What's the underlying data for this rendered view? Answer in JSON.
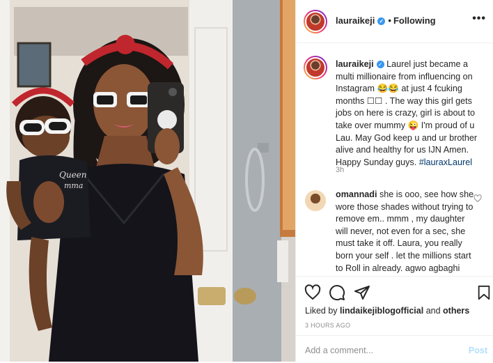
{
  "header": {
    "username": "lauraikeji",
    "separator": "•",
    "follow_status": "Following",
    "more_label": "•••"
  },
  "caption": {
    "username": "lauraikeji",
    "text": "Laurel just became a multi millionaire from influencing on Instagram 😂😂 at just 4 fcuking months ☐☐ . The way this girl gets jobs on here is crazy, girl is about to take over mummy 😜 I'm proud of u Lau. May God keep u and ur brother alive and healthy for us IJN Amen. Happy Sunday guys. ",
    "hashtag": "#lauraxLaurel",
    "time": "3h"
  },
  "comment": {
    "username": "omannadi",
    "text": "she is ooo, see how she wore those shades without trying to remove em.. mmm , my daughter will never, not even for a sec, she must take it off. Laura, you really born your self . let the millions start to Roll in already. agwo agbaghi imu ibe yiri ya. now"
  },
  "likes": {
    "prefix": "Liked by",
    "user": "lindaikejiblogofficial",
    "middle": "and",
    "others": "others"
  },
  "posted": "3 HOURS AGO",
  "add_comment": {
    "placeholder": "Add a comment...",
    "post_label": "Post"
  },
  "icons": [
    "heart-icon",
    "comment-icon",
    "share-icon",
    "bookmark-icon",
    "verified-icon"
  ],
  "colors": {
    "verified": "#3897f0",
    "link": "#00376b",
    "muted": "#8e8e8e",
    "post_disabled": "#b2dffc"
  }
}
